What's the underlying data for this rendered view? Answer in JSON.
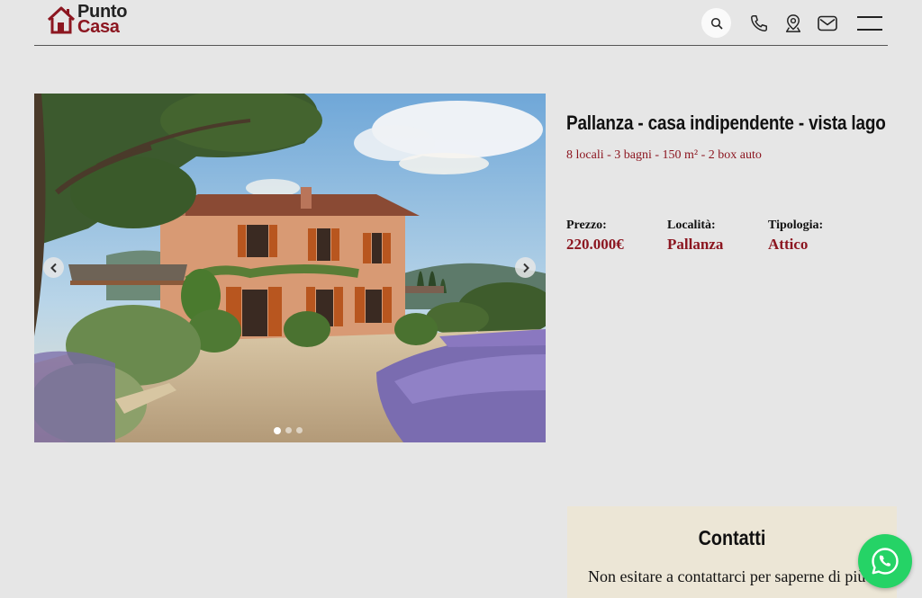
{
  "header": {
    "logo": {
      "line1": "Punto",
      "line2": "Casa"
    },
    "icons": [
      "search-icon",
      "phone-icon",
      "location-pin-icon",
      "mail-icon",
      "menu-icon"
    ]
  },
  "listing": {
    "title": "Pallanza - casa indipendente - vista lago",
    "subtitle": "8 locali - 3 bagni - 150 m² - 2 box auto",
    "specs": [
      {
        "label": "Prezzo:",
        "value": "220.000€"
      },
      {
        "label": "Località:",
        "value": "Pallanza"
      },
      {
        "label": "Tipologia:",
        "value": "Attico"
      }
    ]
  },
  "gallery": {
    "slide_count": 3,
    "active_slide": 1
  },
  "contacts": {
    "title": "Contatti",
    "text": "Non esitare a contattarci per saperne di più"
  },
  "colors": {
    "brand": "#8c1620",
    "background": "#e6e6e6",
    "contacts_bg": "#ece6d6",
    "whatsapp": "#25d366"
  }
}
